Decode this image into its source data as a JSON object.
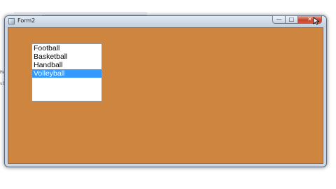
{
  "window": {
    "title": "Form2",
    "app_icon": "form-icon",
    "controls": {
      "minimize": "minimize-icon",
      "maximize": "maximize-icon",
      "close": "close-icon"
    }
  },
  "colors": {
    "client_background": "#cd853f",
    "selection": "#3399ff",
    "titlebar": "#cdd6e3"
  },
  "listbox": {
    "items": [
      "Football",
      "Basketball",
      "Handball",
      "Volleyball"
    ],
    "selected_index": 3
  }
}
